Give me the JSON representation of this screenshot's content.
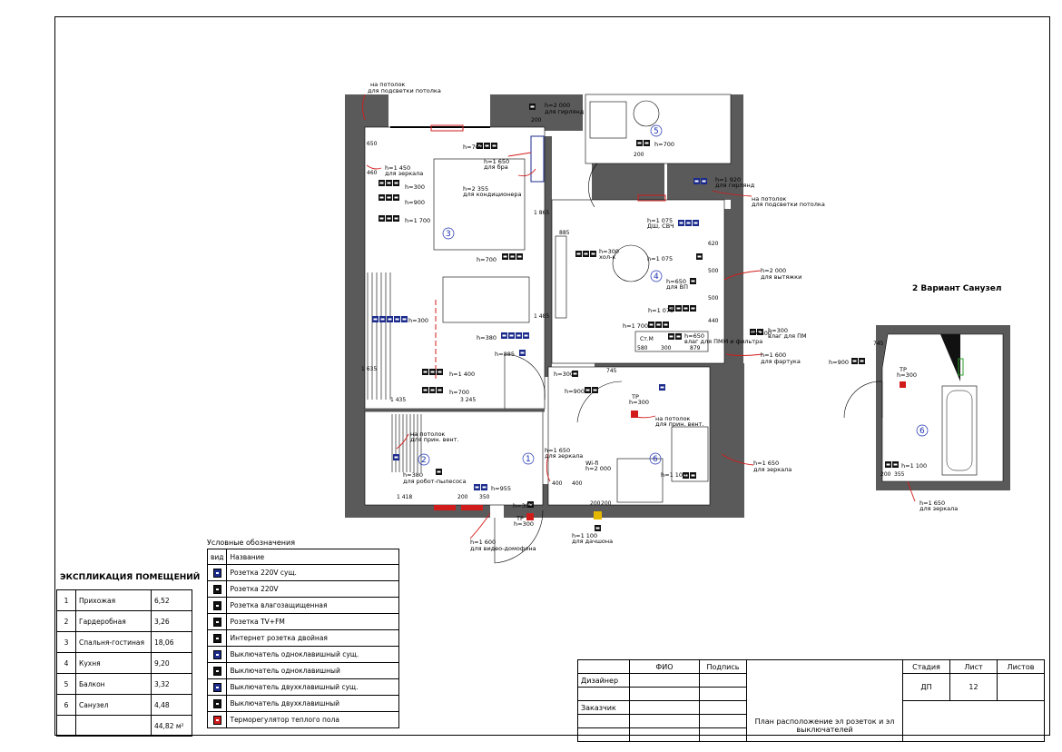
{
  "plan": {
    "notes": {
      "ceiling_top": [
        "на потолок",
        "для подсветки потолка"
      ],
      "garland_top": [
        "h=2 000",
        "для гирлянд"
      ],
      "mirror_left": [
        "h=1 450",
        "для зеркала"
      ],
      "bra": [
        "h=1 650",
        "для бра"
      ],
      "conditioner": [
        "h=2 355",
        "для кондиционера"
      ],
      "garland_right": [
        "h=1 920",
        "для гирлянд"
      ],
      "ceiling_right": [
        "на потолок",
        "для подсветки потолка"
      ],
      "hood": [
        "h=2 000",
        "для вытяжки"
      ],
      "pm": [
        "h=300",
        "влаг для ПМ"
      ],
      "apron": [
        "h=1 600",
        "для фартука"
      ],
      "dishwasher": [
        "h=650",
        "влаг для ПММ и фильтра"
      ],
      "dsh_svch": [
        "h=1 075",
        "ДШ, СВЧ"
      ],
      "fridge": [
        "h=300",
        "хол-к"
      ],
      "vp": [
        "h=650",
        "для ВП"
      ],
      "vent_ceiling": [
        "на потолок",
        "для прин. вент."
      ],
      "vent_ceiling2": [
        "на потолок",
        "для прин. вент."
      ],
      "mirror_hall": [
        "h=1 650",
        "для зеркала"
      ],
      "mirror_bath": [
        "h=1 650",
        "для зеркала"
      ],
      "robot": [
        "h=380",
        "для робот-пылесоса"
      ],
      "intercom": [
        "h=1 600",
        "для видео-домофона"
      ],
      "shower": [
        "h=1 100",
        "для душ. аппарата",
        "h=1 100",
        "для дачшона"
      ],
      "wifi": [
        "Wi-fi",
        "h=2 000"
      ],
      "tp1": [
        "ТР",
        "h=300"
      ],
      "tp2": [
        "ТР",
        "h=300"
      ]
    },
    "heights": {
      "h700a": "h=700",
      "h300a": "h=300",
      "h900a": "h=900",
      "h1700": "h=1 700",
      "h700b": "h=700",
      "h700c": "h=700",
      "h300b": "h=300",
      "h380": "h=380",
      "h885": "h=885",
      "h1400": "h=1 400",
      "h700d": "h=700",
      "h955": "h=955",
      "h300c": "h=300",
      "h900b": "h=900",
      "h300d": "h=300",
      "h1075": "h=1 075",
      "h1075b": "h=1 075",
      "h1700b": "h=1 700",
      "h1100": "h=1 100",
      "h300e": "h=300"
    },
    "dims": {
      "d650": "650",
      "d460": "460",
      "d1865": "1 865",
      "d885": "885",
      "d1485": "1 485",
      "d1635": "1 635",
      "d1435": "1 435",
      "d3245": "3 245",
      "d1418": "1 418",
      "d400a": "400",
      "d400b": "400",
      "d200a": "200",
      "d200b": "200",
      "d580": "580",
      "d300": "300",
      "d879": "879",
      "d620": "620",
      "d500a": "500",
      "d500b": "500",
      "d440": "440",
      "d745a": "745",
      "d745b": "745",
      "d355": "355",
      "d200c": "200",
      "d350a": "350",
      "d350b": "350",
      "d200d": "200",
      "d200e": "200"
    },
    "labels": {
      "cm": "Ст.М"
    },
    "rooms": [
      "1",
      "2",
      "3",
      "4",
      "5",
      "6"
    ]
  },
  "variant": {
    "title": "2 Вариант Санузел",
    "room": "6",
    "h900": "h=900",
    "tp": [
      "ТР",
      "h=300"
    ],
    "h1100": "h=1 100",
    "d200": "200",
    "d355": "355",
    "d745": "745",
    "mirror": [
      "h=1 650",
      "для зеркала"
    ]
  },
  "legend": {
    "caption": "Условные обозначения",
    "col_view": "вид",
    "col_name": "Название",
    "items": [
      {
        "name": "Розетка 220V сущ.",
        "color": "#1b2b8c"
      },
      {
        "name": "Розетка 220V",
        "color": "#111111"
      },
      {
        "name": "Розетка влагозащищенная",
        "color": "#111111"
      },
      {
        "name": "Розетка TV+FM",
        "color": "#111111"
      },
      {
        "name": "Интернет розетка двойная",
        "color": "#111111"
      },
      {
        "name": "Выключатель одноклавишный сущ.",
        "color": "#1b2b8c"
      },
      {
        "name": "Выключатель одноклавишный",
        "color": "#111111"
      },
      {
        "name": "Выключатель двухклавишный сущ.",
        "color": "#1b2b8c"
      },
      {
        "name": "Выключатель двухклавишный",
        "color": "#111111"
      },
      {
        "name": "Терморегулятор теплого пола",
        "color": "#d21b1b"
      }
    ]
  },
  "explication": {
    "title": "ЭКСПЛИКАЦИЯ ПОМЕЩЕНИЙ",
    "rows": [
      {
        "n": "1",
        "name": "Прихожая",
        "area": "6,52"
      },
      {
        "n": "2",
        "name": "Гардеробная",
        "area": "3,26"
      },
      {
        "n": "3",
        "name": "Спальня-гостиная",
        "area": "18,06"
      },
      {
        "n": "4",
        "name": "Кухня",
        "area": "9,20"
      },
      {
        "n": "5",
        "name": "Балкон",
        "area": "3,32"
      },
      {
        "n": "6",
        "name": "Санузел",
        "area": "4,48"
      }
    ],
    "total": "44,82 м²"
  },
  "stamp": {
    "fio": "ФИО",
    "sign": "Подпись",
    "designer": "Дизайнер",
    "customer": "Заказчик",
    "stage": "Стадия",
    "sheet": "Лист",
    "sheets": "Листов",
    "stage_val": "ДП",
    "sheet_val": "12",
    "title": "План расположение эл розеток и эл выключателей"
  }
}
